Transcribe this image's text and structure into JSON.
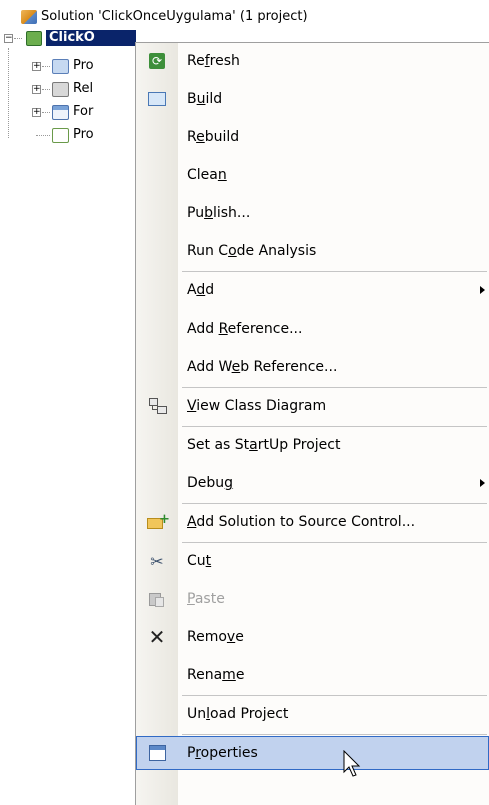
{
  "tree": {
    "solution_label": "Solution 'ClickOnceUygulama' (1 project)",
    "project_label": "ClickO",
    "children": [
      "Pro",
      "Rel",
      "For",
      "Pro"
    ]
  },
  "menu": {
    "items": [
      {
        "label": "Refresh",
        "icon": "refresh-icon"
      },
      {
        "label": "Build",
        "icon": "build-icon"
      },
      {
        "label": "Rebuild"
      },
      {
        "label": "Clean"
      },
      {
        "label": "Publish..."
      },
      {
        "label": "Run Code Analysis"
      },
      {
        "label": "Add",
        "submenu": true
      },
      {
        "label": "Add Reference..."
      },
      {
        "label": "Add Web Reference..."
      },
      {
        "label": "View Class Diagram",
        "icon": "class-diagram-icon"
      },
      {
        "label": "Set as StartUp Project"
      },
      {
        "label": "Debug",
        "submenu": true
      },
      {
        "label": "Add Solution to Source Control...",
        "icon": "source-control-icon"
      },
      {
        "label": "Cut",
        "icon": "scissors-icon"
      },
      {
        "label": "Paste",
        "icon": "paste-icon",
        "disabled": true
      },
      {
        "label": "Remove",
        "icon": "remove-icon"
      },
      {
        "label": "Rename"
      },
      {
        "label": "Unload Project"
      },
      {
        "label": "Properties",
        "icon": "properties-icon",
        "hovered": true
      }
    ]
  },
  "colors": {
    "selection": "#0a246a",
    "menu_hover": "#c1d2ee",
    "menu_hover_border": "#316ac5"
  }
}
